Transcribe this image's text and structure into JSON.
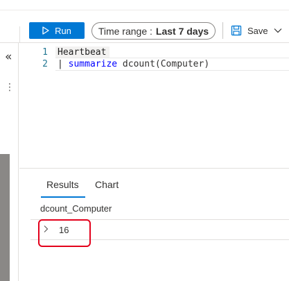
{
  "toolbar": {
    "run_label": "Run",
    "time_range_label": "Time range :",
    "time_range_value": "Last 7 days",
    "save_label": "Save",
    "accent_color": "#0078d4"
  },
  "rail": {
    "collapse_icon": "double-chevron-left-icon",
    "collapse_glyph": "«",
    "more_icon": "more-vertical-icon",
    "more_glyph": "⋮"
  },
  "editor": {
    "lines": [
      {
        "number": "1",
        "text": "Heartbeat"
      },
      {
        "number": "2",
        "pipe": "| ",
        "operator": "summarize",
        "rest": " dcount(Computer)"
      }
    ]
  },
  "results": {
    "tabs": [
      {
        "label": "Results",
        "active": true
      },
      {
        "label": "Chart",
        "active": false
      }
    ],
    "columns": [
      "dcount_Computer"
    ],
    "rows": [
      {
        "values": [
          "16"
        ]
      }
    ],
    "highlight_color": "#e3001b"
  }
}
